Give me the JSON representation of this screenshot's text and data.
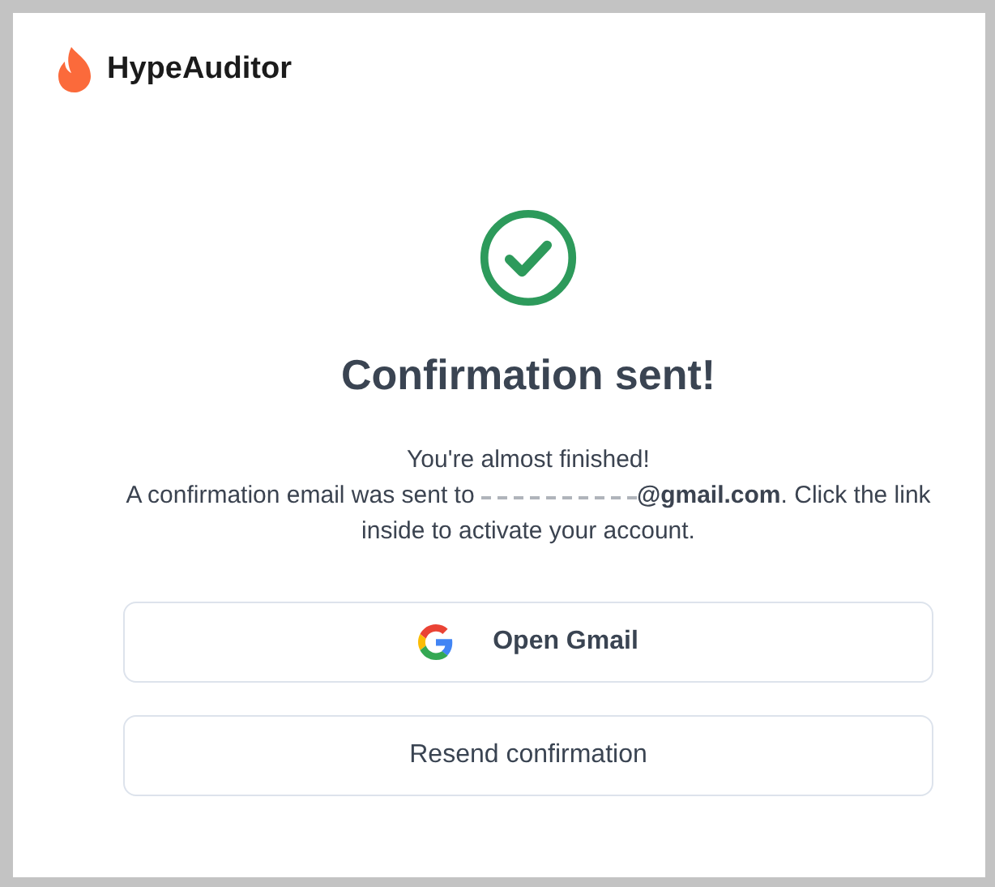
{
  "brand": {
    "name": "HypeAuditor"
  },
  "status": {
    "kind": "success",
    "title": "Confirmation sent!"
  },
  "message": {
    "intro": "You're almost finished!",
    "before_address": "A confirmation email was sent to",
    "after_address": "**@gmail.com**. Click the link inside to activate your account."
  },
  "buttons": [
    {
      "kind": "google",
      "label": "Open Gmail"
    },
    {
      "kind": "plain",
      "label": "Resend confirmation"
    }
  ]
}
